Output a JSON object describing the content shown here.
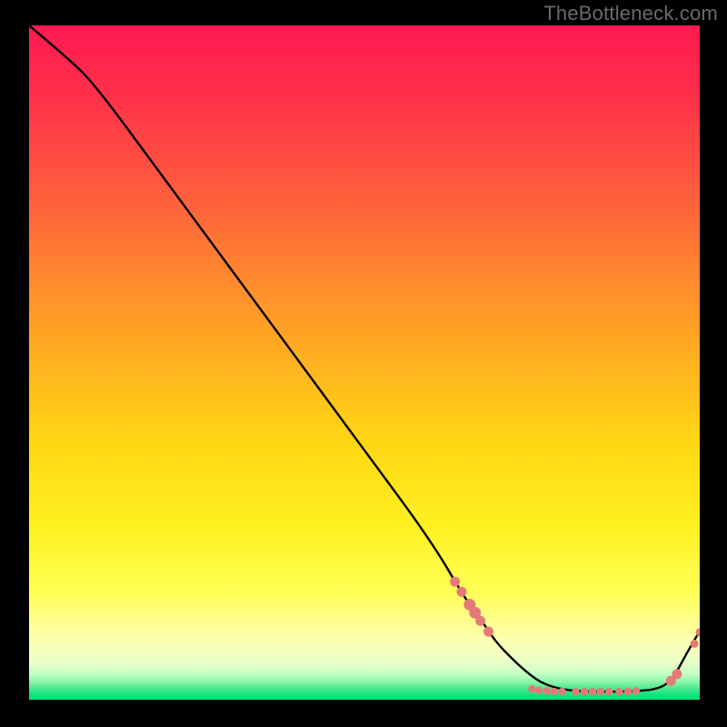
{
  "watermark": "TheBottleneck.com",
  "chart_data": {
    "type": "line",
    "title": "",
    "xlabel": "",
    "ylabel": "",
    "xlim": [
      0,
      100
    ],
    "ylim": [
      0,
      100
    ],
    "grid": false,
    "legend": false,
    "series": [
      {
        "name": "curve",
        "x": [
          0,
          6,
          10,
          20,
          30,
          40,
          50,
          60,
          65,
          68,
          70,
          75,
          78,
          82,
          86,
          90,
          94,
          96,
          98,
          100
        ],
        "y": [
          100,
          95,
          91,
          77.5,
          64,
          50.5,
          37,
          23.5,
          15,
          11,
          8,
          3.3,
          1.8,
          1.2,
          1.2,
          1.2,
          1.6,
          3.1,
          6.8,
          10.2
        ]
      }
    ],
    "markers": {
      "color": "#e47a78",
      "points": [
        {
          "x": 63.5,
          "y": 17.5,
          "r": 5.5
        },
        {
          "x": 64.5,
          "y": 16.0,
          "r": 5.5
        },
        {
          "x": 65.7,
          "y": 14.1,
          "r": 6.5
        },
        {
          "x": 66.5,
          "y": 12.9,
          "r": 6.5
        },
        {
          "x": 67.3,
          "y": 11.7,
          "r": 5.5
        },
        {
          "x": 68.5,
          "y": 10.1,
          "r": 5.5
        },
        {
          "x": 75.0,
          "y": 1.6,
          "r": 4.2
        },
        {
          "x": 76.0,
          "y": 1.4,
          "r": 4.2
        },
        {
          "x": 77.2,
          "y": 1.3,
          "r": 4.2
        },
        {
          "x": 78.3,
          "y": 1.2,
          "r": 4.2
        },
        {
          "x": 79.5,
          "y": 1.2,
          "r": 4.2
        },
        {
          "x": 81.5,
          "y": 1.2,
          "r": 4.2
        },
        {
          "x": 82.8,
          "y": 1.2,
          "r": 4.2
        },
        {
          "x": 84.0,
          "y": 1.2,
          "r": 4.2
        },
        {
          "x": 85.2,
          "y": 1.2,
          "r": 4.2
        },
        {
          "x": 86.5,
          "y": 1.2,
          "r": 4.2
        },
        {
          "x": 88.0,
          "y": 1.2,
          "r": 4.2
        },
        {
          "x": 89.3,
          "y": 1.2,
          "r": 4.2
        },
        {
          "x": 90.5,
          "y": 1.3,
          "r": 4.2
        },
        {
          "x": 95.7,
          "y": 2.8,
          "r": 5.5
        },
        {
          "x": 96.6,
          "y": 3.8,
          "r": 5.5
        },
        {
          "x": 99.2,
          "y": 8.3,
          "r": 4.5
        },
        {
          "x": 100.0,
          "y": 10.0,
          "r": 4.5
        }
      ]
    }
  }
}
